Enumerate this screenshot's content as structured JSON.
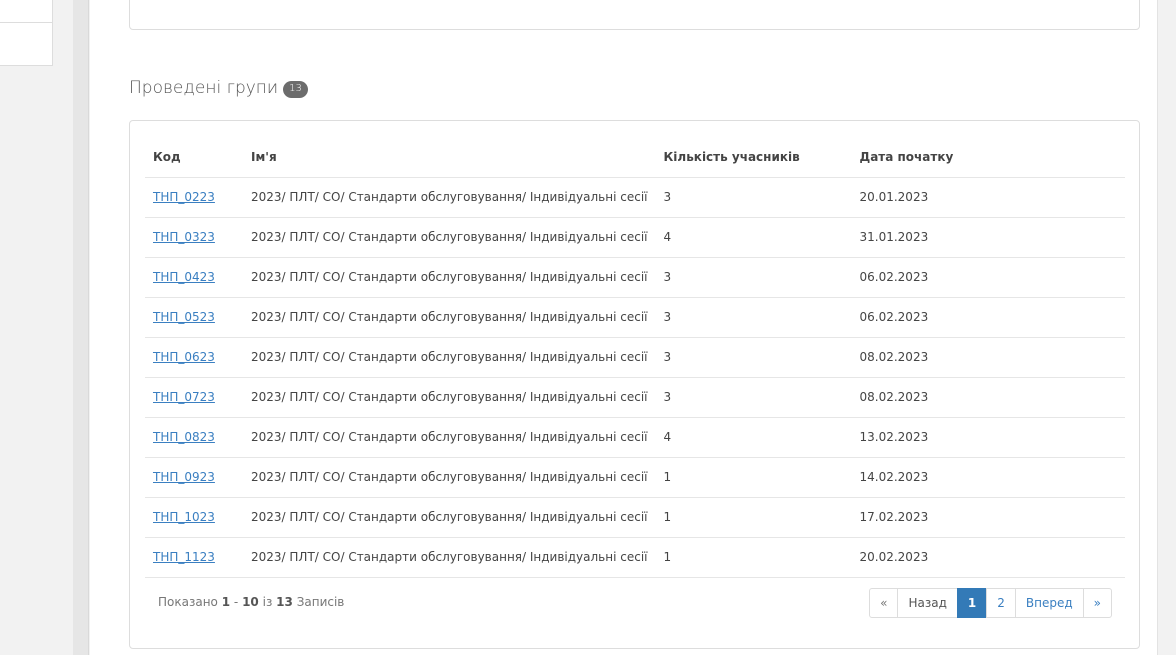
{
  "section": {
    "title": "Проведені групи",
    "badge": "13"
  },
  "table": {
    "headers": {
      "code": "Код",
      "name": "Ім'я",
      "count": "Кількість учасників",
      "date": "Дата початку"
    },
    "rows": [
      {
        "code": "ТНП_0223",
        "name": "2023/ ПЛТ/ СО/ Стандарти обслуговування/ Індивідуальні сесії",
        "count": "3",
        "date": "20.01.2023"
      },
      {
        "code": "ТНП_0323",
        "name": "2023/ ПЛТ/ СО/ Стандарти обслуговування/ Індивідуальні сесії",
        "count": "4",
        "date": "31.01.2023"
      },
      {
        "code": "ТНП_0423",
        "name": "2023/ ПЛТ/ СО/ Стандарти обслуговування/ Індивідуальні сесії",
        "count": "3",
        "date": "06.02.2023"
      },
      {
        "code": "ТНП_0523",
        "name": "2023/ ПЛТ/ СО/ Стандарти обслуговування/ Індивідуальні сесії",
        "count": "3",
        "date": "06.02.2023"
      },
      {
        "code": "ТНП_0623",
        "name": "2023/ ПЛТ/ СО/ Стандарти обслуговування/ Індивідуальні сесії",
        "count": "3",
        "date": "08.02.2023"
      },
      {
        "code": "ТНП_0723",
        "name": "2023/ ПЛТ/ СО/ Стандарти обслуговування/ Індивідуальні сесії",
        "count": "3",
        "date": "08.02.2023"
      },
      {
        "code": "ТНП_0823",
        "name": "2023/ ПЛТ/ СО/ Стандарти обслуговування/ Індивідуальні сесії",
        "count": "4",
        "date": "13.02.2023"
      },
      {
        "code": "ТНП_0923",
        "name": "2023/ ПЛТ/ СО/ Стандарти обслуговування/ Індивідуальні сесії",
        "count": "1",
        "date": "14.02.2023"
      },
      {
        "code": "ТНП_1023",
        "name": "2023/ ПЛТ/ СО/ Стандарти обслуговування/ Індивідуальні сесії",
        "count": "1",
        "date": "17.02.2023"
      },
      {
        "code": "ТНП_1123",
        "name": "2023/ ПЛТ/ СО/ Стандарти обслуговування/ Індивідуальні сесії",
        "count": "1",
        "date": "20.02.2023"
      }
    ]
  },
  "info": {
    "prefix": "Показано",
    "from": "1",
    "dash": "-",
    "to": "10",
    "of": "із",
    "total": "13",
    "suffix": "Записів"
  },
  "pagination": {
    "first": "«",
    "prev": "Назад",
    "page1": "1",
    "page2": "2",
    "next": "Вперед",
    "last": "»"
  },
  "colors": {
    "link": "#3a7fc1",
    "active_page": "#337ab7",
    "badge": "#6c6c6c"
  }
}
